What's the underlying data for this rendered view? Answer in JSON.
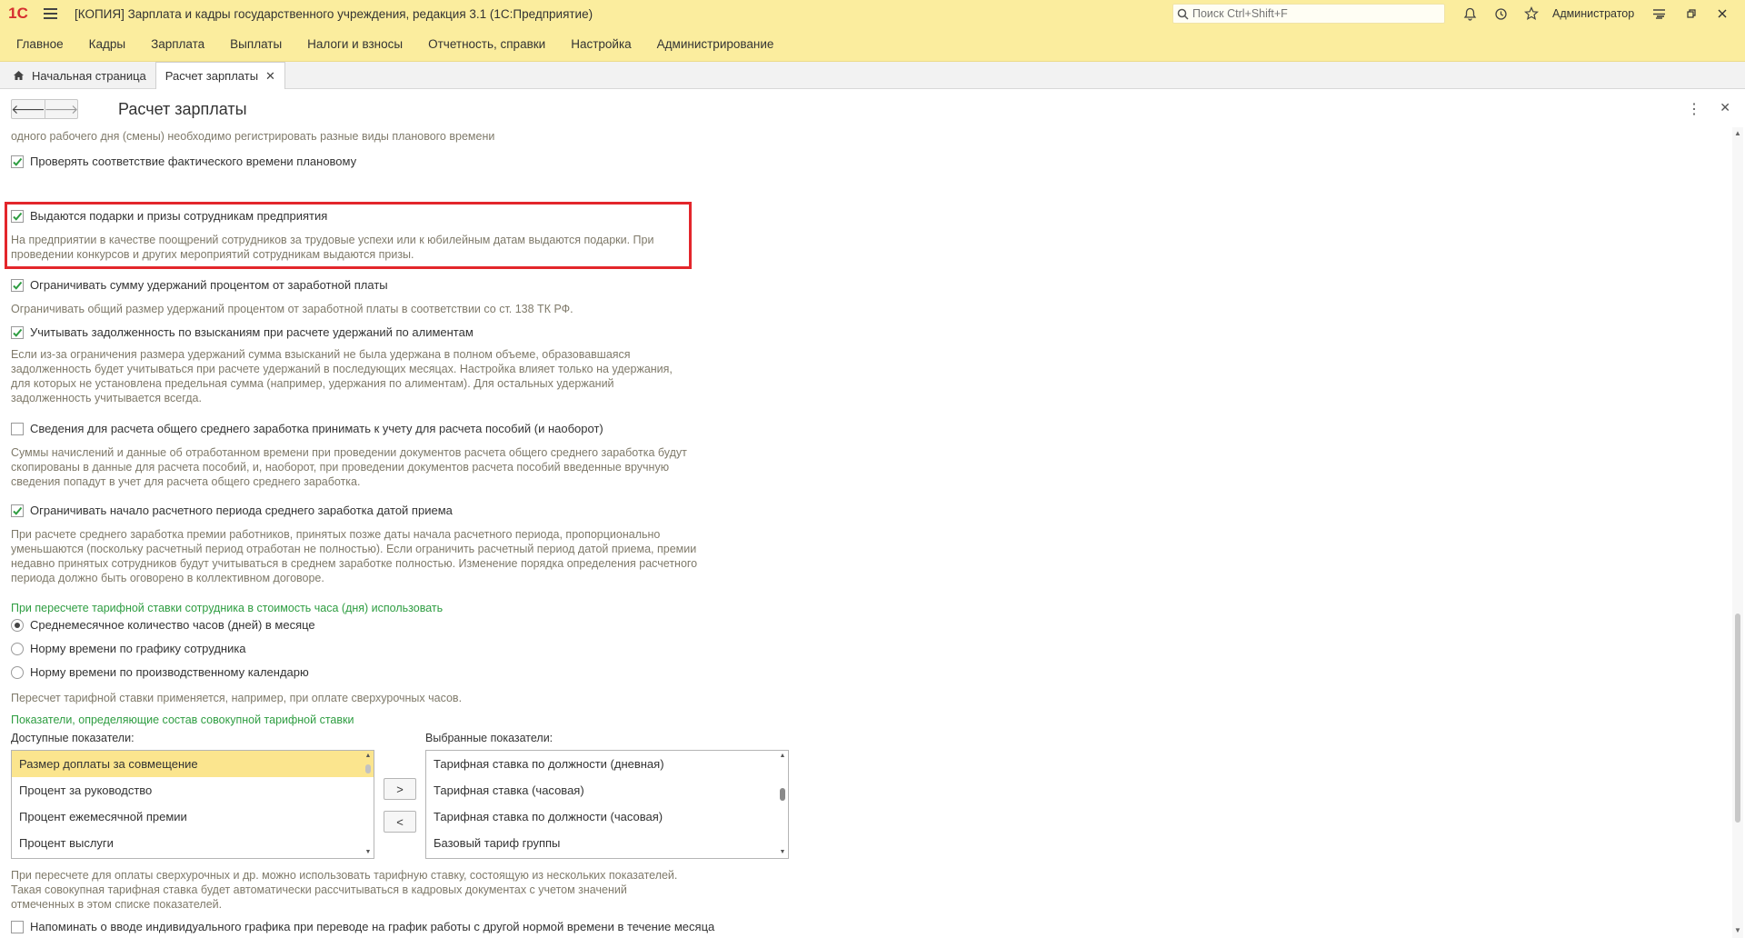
{
  "titlebar": {
    "logo": "1С",
    "title": "[КОПИЯ] Зарплата и кадры государственного учреждения, редакция 3.1  (1С:Предприятие)",
    "search_placeholder": "Поиск Ctrl+Shift+F",
    "user": "Администратор"
  },
  "menu": [
    "Главное",
    "Кадры",
    "Зарплата",
    "Выплаты",
    "Налоги и взносы",
    "Отчетность, справки",
    "Настройка",
    "Администрирование"
  ],
  "tabs": {
    "home": "Начальная страница",
    "active": "Расчет зарплаты"
  },
  "form": {
    "title": "Расчет зарплаты"
  },
  "content": {
    "top_note": "одного рабочего дня (смены) необходимо регистрировать разные виды планового времени",
    "cb_check_time": {
      "label": "Проверять соответствие фактического времени плановому",
      "checked": true
    },
    "cb_gifts": {
      "label": "Выдаются подарки и призы сотрудникам предприятия",
      "checked": true
    },
    "gifts_note": "На предприятии в качестве поощрений сотрудников за трудовые успехи или к юбилейным датам выдаются подарки. При проведении конкурсов и других мероприятий сотрудникам выдаются призы.",
    "cb_limit_deductions": {
      "label": "Ограничивать сумму удержаний процентом от заработной платы",
      "checked": true
    },
    "limit_note": "Ограничивать общий размер удержаний процентом от заработной платы в соответствии со ст. 138 ТК РФ.",
    "cb_debt": {
      "label": "Учитывать задолженность по взысканиям при расчете удержаний по алиментам",
      "checked": true
    },
    "debt_note": "Если из-за ограничения размера удержаний сумма взысканий не была удержана в полном объеме, образовавшаяся задолженность будет учитываться при расчете удержаний в последующих месяцах. Настройка влияет только на удержания, для которых не установлена предельная сумма (например, удержания по алиментам). Для остальных удержаний задолженность учитывается всегда.",
    "cb_avg": {
      "label": "Сведения для расчета общего среднего заработка принимать к учету для расчета пособий (и наоборот)",
      "checked": false
    },
    "avg_note": "Суммы начислений и данные об отработанном времени при проведении документов расчета общего среднего заработка будут скопированы в данные для расчета пособий, и, наоборот, при проведении документов расчета пособий введенные вручную сведения попадут в учет для расчета общего среднего заработка.",
    "cb_period": {
      "label": "Ограничивать начало расчетного периода среднего заработка датой приема",
      "checked": true
    },
    "period_note": "При расчете среднего заработка премии работников, принятых позже даты начала расчетного периода, пропорционально уменьшаются (поскольку расчетный период отработан не полностью). Если ограничить расчетный период датой приема, премии недавно принятых сотрудников будут учитываться в среднем заработке полностью. Изменение порядка определения расчетного периода должно быть оговорено в коллективном договоре.",
    "rate_section": "При пересчете тарифной ставки сотрудника в стоимость часа (дня) использовать",
    "radios": [
      {
        "label": "Среднемесячное количество часов (дней) в месяце",
        "selected": true
      },
      {
        "label": "Норму времени по графику сотрудника",
        "selected": false
      },
      {
        "label": "Норму времени по производственному календарю",
        "selected": false
      }
    ],
    "rate_note": "Пересчет тарифной ставки применяется, например, при оплате сверхурочных часов.",
    "indicators_section": "Показатели, определяющие состав совокупной тарифной ставки",
    "available_label": "Доступные показатели:",
    "selected_label": "Выбранные показатели:",
    "available": [
      "Размер доплаты за совмещение",
      "Процент за руководство",
      "Процент ежемесячной премии",
      "Процент выслуги"
    ],
    "selected": [
      "Тарифная ставка по должности (дневная)",
      "Тарифная ставка (часовая)",
      "Тарифная ставка по должности (часовая)",
      "Базовый тариф группы"
    ],
    "btn_add": ">",
    "btn_remove": "<",
    "composite_note": "При пересчете для оплаты сверхурочных и др. можно использовать тарифную ставку, состоящую из нескольких показателей. Такая совокупная тарифная ставка будет автоматически рассчитываться в кадровых документах с учетом значений отмеченных в этом списке показателей.",
    "cb_remind": {
      "label": "Напоминать о вводе индивидуального графика при переводе на график работы с другой нормой времени в течение месяца",
      "checked": false
    }
  },
  "colors": {
    "header_bg": "#fbed9e",
    "highlight": "#e3262b",
    "section": "#2e9d41",
    "selected_row": "#fbe58e"
  }
}
